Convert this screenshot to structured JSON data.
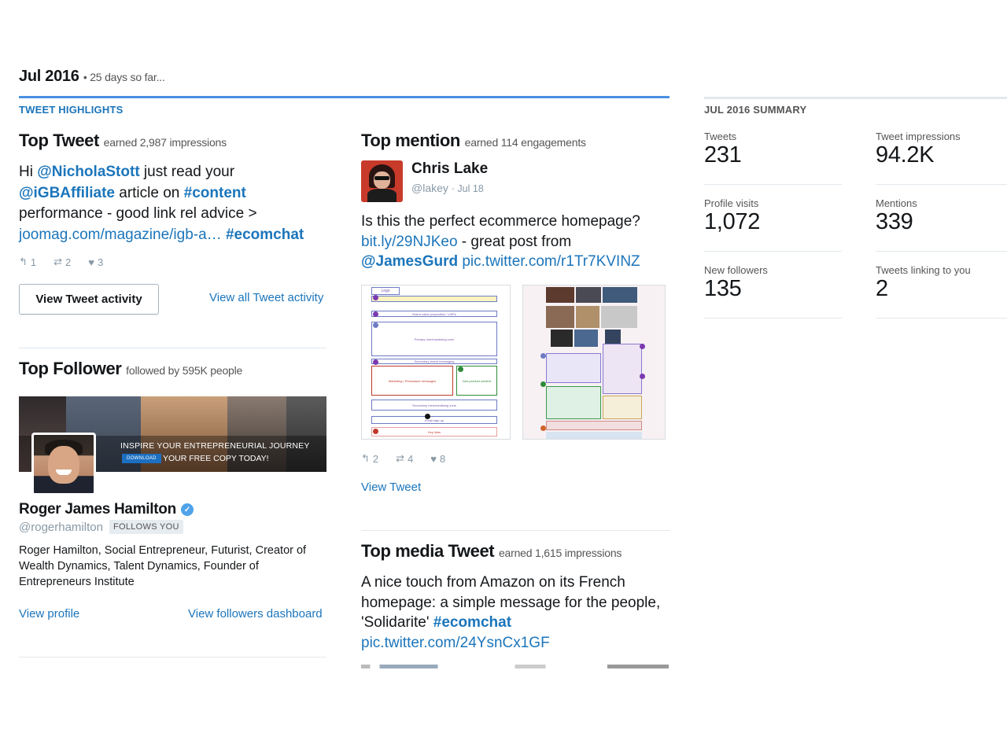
{
  "header": {
    "month": "Jul 2016",
    "subtitle": "• 25 days so far..."
  },
  "highlights": {
    "section_label": "TWEET HIGHLIGHTS",
    "top_tweet": {
      "title": "Top Tweet",
      "earned": "earned 2,987 impressions",
      "text_prefix": "Hi ",
      "mention1": "@NicholaStott",
      "text_mid1": " just read your",
      "mention2": "@iGBAffiliate",
      "text_mid2": " article on ",
      "hashtag1": "#content",
      "text_line3": "performance - good link rel advice >",
      "link": "joomag.com/magazine/igb-a…",
      "hashtag2": "#ecomchat",
      "replies": "1",
      "retweets": "2",
      "likes": "3",
      "view_activity_button": "View Tweet activity",
      "view_all_link": "View all Tweet activity"
    },
    "top_follower": {
      "title": "Top Follower",
      "followed_by": "followed by 595K people",
      "banner_line1": "INSPIRE YOUR ENTREPRENEURIAL JOURNEY",
      "banner_download": "DOWNLOAD",
      "banner_line2": "YOUR FREE COPY TODAY!",
      "name": "Roger James Hamilton",
      "handle": "@rogerhamilton",
      "follows_you": "FOLLOWS YOU",
      "bio": "Roger Hamilton, Social Entrepreneur, Futurist, Creator of Wealth Dynamics, Talent Dynamics, Founder of Entrepreneurs Institute",
      "view_profile": "View profile",
      "view_dashboard": "View followers dashboard"
    },
    "top_mention": {
      "title": "Top mention",
      "earned": "earned 114 engagements",
      "name": "Chris Lake",
      "handle": "@lakey",
      "date": "· Jul 18",
      "text_line1": "Is this the perfect ecommerce homepage?",
      "link1": "bit.ly/29NJKeo",
      "text_mid": " - great post from",
      "mention": "@JamesGurd",
      "link2": " pic.twitter.com/r1Tr7KVINZ",
      "replies": "2",
      "retweets": "4",
      "likes": "8",
      "view_tweet": "View Tweet",
      "wireframe_labels": [
        "Logo",
        "Brand value proposition / USPs",
        "Primary merchandising zone",
        "Secondary brand messaging",
        "Marketing / Persuasion messages",
        "Non-product content",
        "Secondary merchandising zone",
        "Email sign-up",
        "Key links"
      ]
    },
    "top_media": {
      "title": "Top media Tweet",
      "earned": "earned 1,615 impressions",
      "text_line1": "A nice touch from Amazon on its French",
      "text_line2": "homepage: a simple message for the people,",
      "text_line3_prefix": "'Solidarite' ",
      "hashtag": "#ecomchat",
      "link": "pic.twitter.com/24YsnCx1GF"
    }
  },
  "summary": {
    "label": "JUL 2016 SUMMARY",
    "stats": [
      {
        "label": "Tweets",
        "value": "231"
      },
      {
        "label": "Tweet impressions",
        "value": "94.2K"
      },
      {
        "label": "Profile visits",
        "value": "1,072"
      },
      {
        "label": "Mentions",
        "value": "339"
      },
      {
        "label": "New followers",
        "value": "135"
      },
      {
        "label": "Tweets linking to you",
        "value": "2"
      }
    ]
  },
  "colors": {
    "link": "#1b75bb",
    "accent_rule": "#4a90e2",
    "muted": "#8899a6"
  }
}
